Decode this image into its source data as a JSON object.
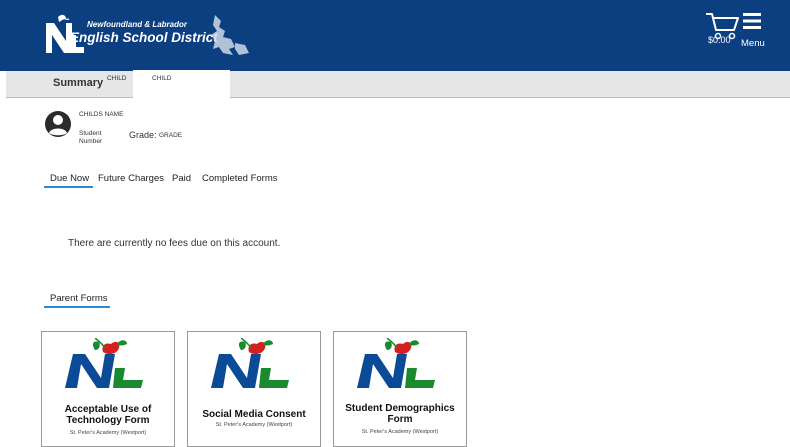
{
  "header": {
    "logo_line1": "Newfoundland & Labrador",
    "logo_line2": "English School District",
    "cart_amount": "$0.00",
    "menu_label": "Menu",
    "bg_color": "#0b3f80"
  },
  "tabs": {
    "summary": "Summary",
    "child1": "CHILD",
    "child2": "CHILD"
  },
  "student": {
    "name": "CHILDS NAME",
    "number_label": "Student Number",
    "grade_label": "Grade:",
    "grade_value": "GRADE"
  },
  "fee_tabs": [
    "Due Now",
    "Future Charges",
    "Paid",
    "Completed Forms"
  ],
  "active_fee_tab": "Due Now",
  "no_fees_message": "There are currently no fees due on this account.",
  "parent_forms_label": "Parent Forms",
  "forms": [
    {
      "title": "Acceptable Use of Technology Form",
      "school": "St. Peter's Academy (Westport)"
    },
    {
      "title": "Social Media Consent",
      "school": "St. Peter's Academy (Westport)"
    },
    {
      "title": "Student Demographics Form",
      "school": "St. Peter's Academy (Westport)"
    }
  ],
  "colors": {
    "accent_underline": "#2b8ad6",
    "logo_blue": "#0b4a97",
    "logo_green": "#1a8a2e",
    "logo_red": "#d62020"
  }
}
